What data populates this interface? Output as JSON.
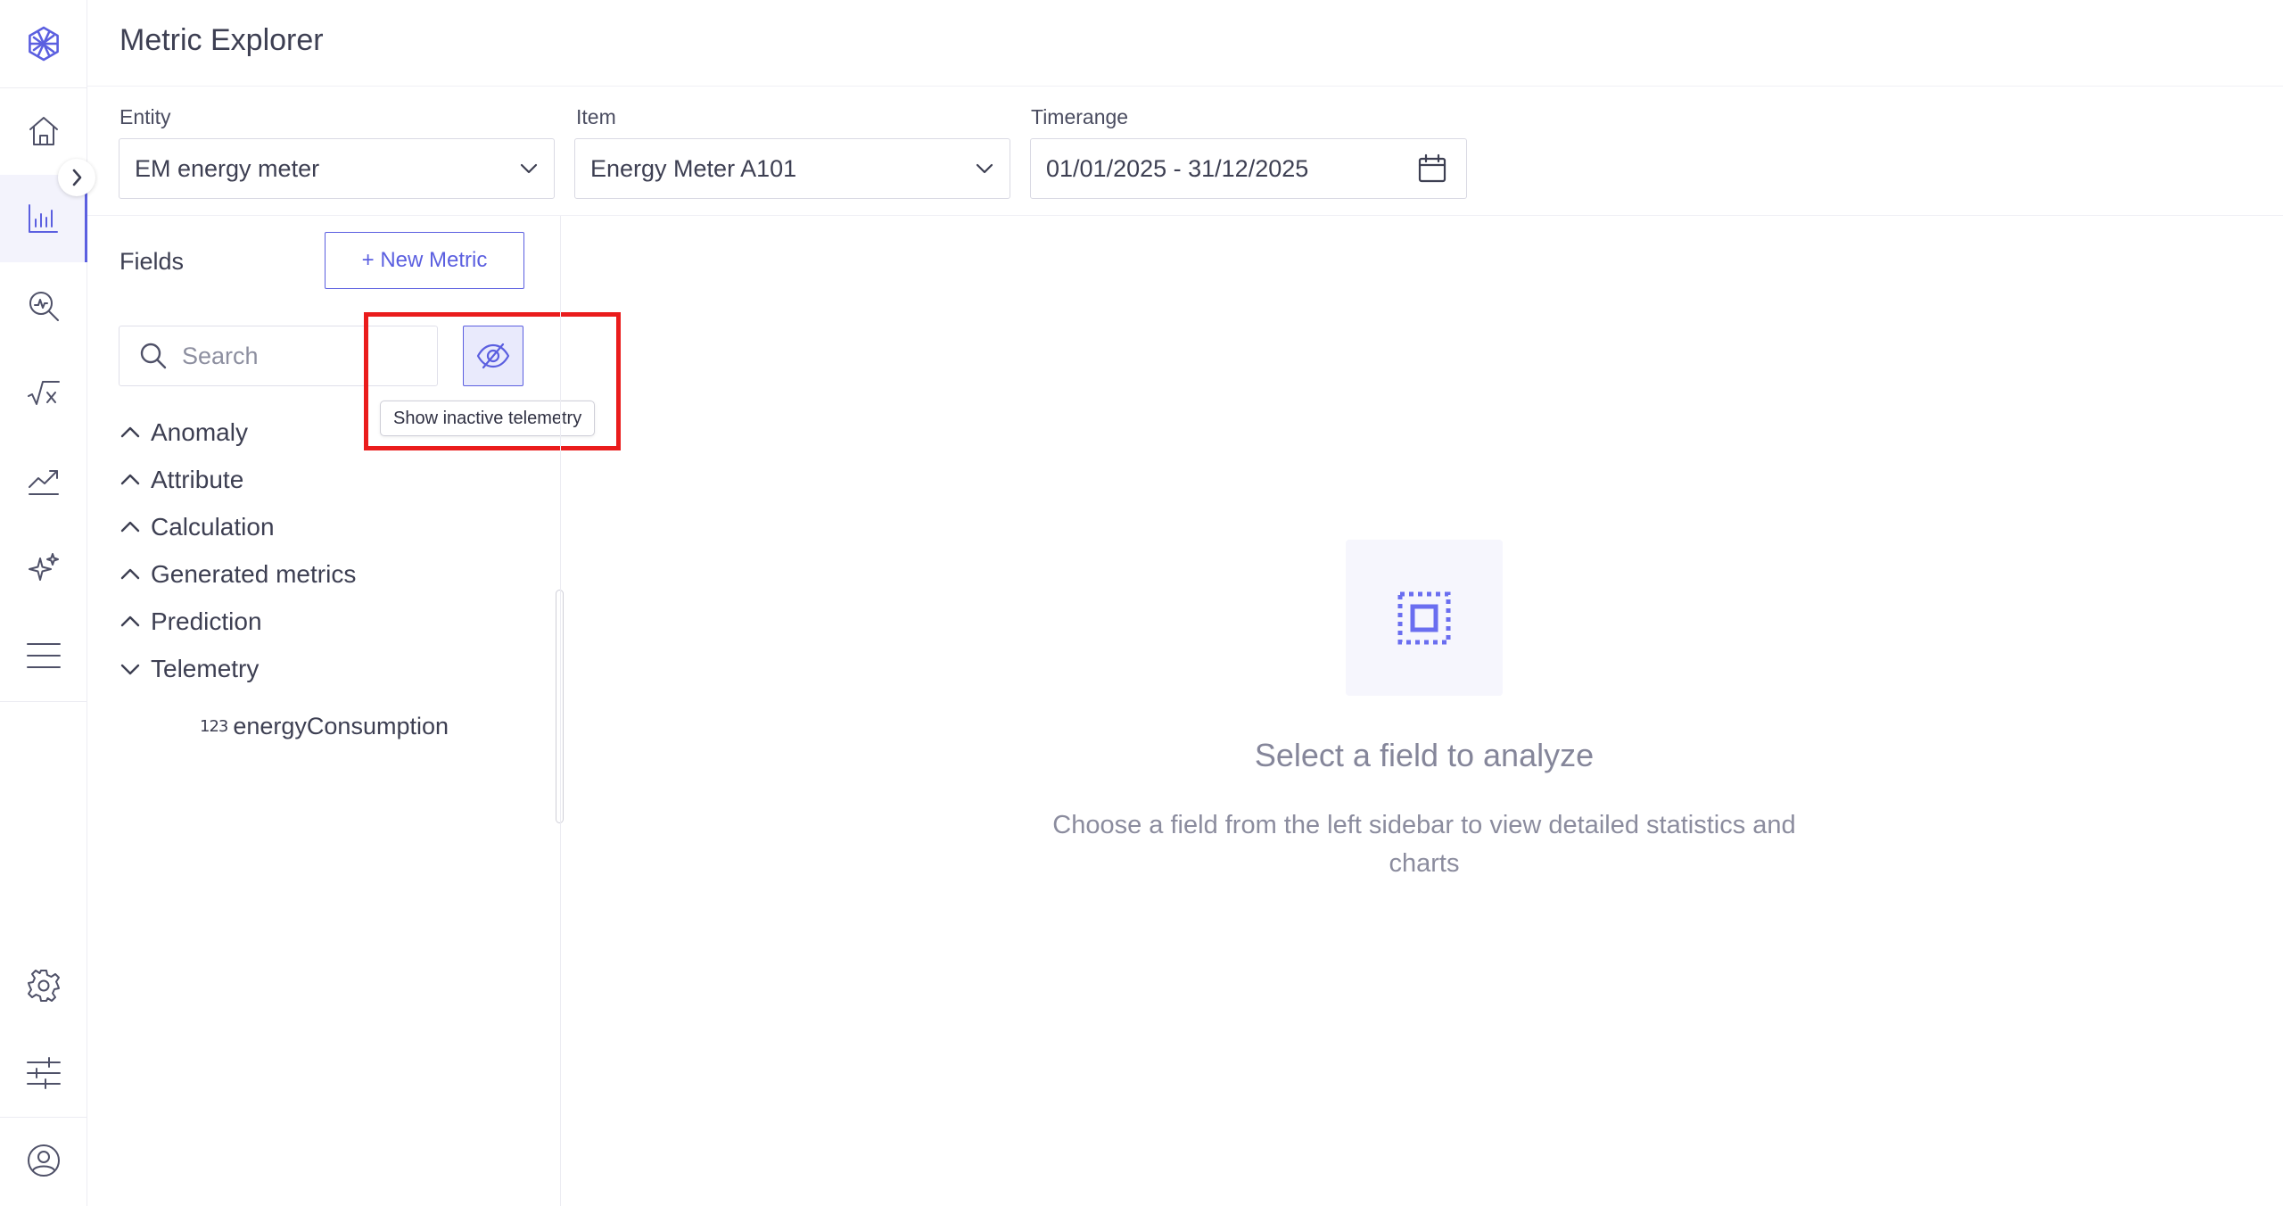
{
  "app": {
    "title": "Metric Explorer",
    "accent_color": "#5b5fe0",
    "highlight_color": "#ea1c1c"
  },
  "rail": {
    "logo_icon": "hexagon-logo-icon",
    "items": [
      {
        "icon": "home-icon",
        "active": false
      },
      {
        "icon": "bar-chart-icon",
        "active": true
      },
      {
        "icon": "search-analytics-icon",
        "active": false
      },
      {
        "icon": "formula-icon",
        "active": false
      },
      {
        "icon": "trend-icon",
        "active": false
      },
      {
        "icon": "sparkle-icon",
        "active": false
      },
      {
        "icon": "menu-icon",
        "active": false
      }
    ],
    "bottom_items": [
      {
        "icon": "gear-icon"
      },
      {
        "icon": "sliders-icon"
      },
      {
        "icon": "user-icon"
      }
    ]
  },
  "filters": {
    "entity": {
      "label": "Entity",
      "value": "EM energy meter"
    },
    "item": {
      "label": "Item",
      "value": "Energy Meter A101"
    },
    "timerange": {
      "label": "Timerange",
      "value": "01/01/2025 - 31/12/2025"
    }
  },
  "fields_panel": {
    "title": "Fields",
    "new_metric_label": "+ New Metric",
    "search_placeholder": "Search",
    "toggle_tooltip": "Show inactive telemetry",
    "groups": [
      {
        "label": "Anomaly",
        "expanded": false
      },
      {
        "label": "Attribute",
        "expanded": false
      },
      {
        "label": "Calculation",
        "expanded": false
      },
      {
        "label": "Generated metrics",
        "expanded": false
      },
      {
        "label": "Prediction",
        "expanded": false
      },
      {
        "label": "Telemetry",
        "expanded": true
      }
    ],
    "telemetry_items": [
      {
        "type_icon": "123",
        "label": "energyConsumption"
      }
    ]
  },
  "empty_state": {
    "title": "Select a field to analyze",
    "description": "Choose a field from the left sidebar to view detailed statistics and charts"
  }
}
